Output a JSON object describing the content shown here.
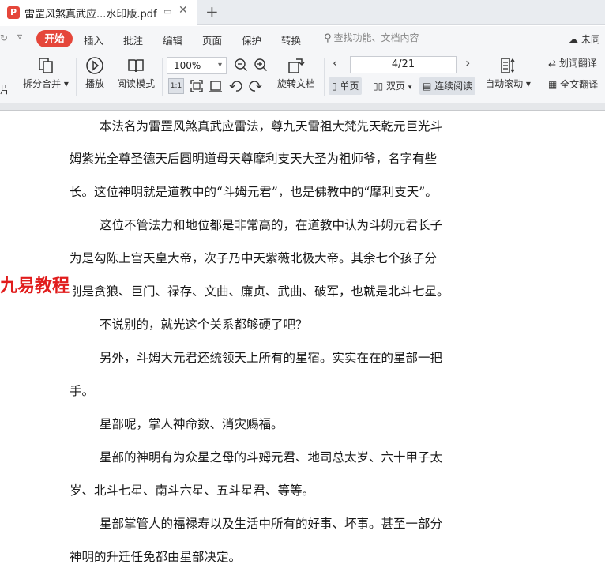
{
  "tab": {
    "title": "雷罡风煞真武应...水印版.pdf",
    "pdf_icon": "P",
    "pin": "▭",
    "close": "✕",
    "new_tab": "+"
  },
  "menu": {
    "left_undo": "↻",
    "caret": "▿",
    "items": [
      "开始",
      "插入",
      "批注",
      "编辑",
      "页面",
      "保护",
      "转换"
    ],
    "search_placeholder": "查找功能、文档内容",
    "sync_label": "未同"
  },
  "toolbar": {
    "left_partial": "片",
    "split_merge": "拆分合并",
    "play": "播放",
    "read_mode": "阅读模式",
    "zoom_value": "100%",
    "rotate_doc": "旋转文档",
    "page_indicator": "4/21",
    "single_page": "单页",
    "double_page": "双页",
    "continuous": "连续阅读",
    "auto_scroll": "自动滚动",
    "word_translate": "划词翻译",
    "full_translate": "全文翻译"
  },
  "document": {
    "lines": [
      "本法名为雷罡风煞真武应雷法，尊九天雷祖大梵先天乾元巨光斗",
      "姆紫光全尊圣德天后圆明道母天尊摩利支天大圣为祖师爷，名字有些",
      "长。这位神明就是道教中的“斗姆元君”，也是佛教中的“摩利支天”。",
      "这位不管法力和地位都是非常高的，在道教中认为斗姆元君长子",
      "为是勾陈上宫天皇大帝，次子乃中天紫薇北极大帝。其余七个孩子分",
      "别是贪狼、巨门、禄存、文曲、廉贞、武曲、破军，也就是北斗七星。",
      "不说别的，就光这个关系都够硬了吧？",
      "另外，斗姆大元君还统领天上所有的星宿。实实在在的星部一把",
      "手。",
      "星部呢，掌人神命数、消灾赐福。",
      "星部的神明有为众星之母的斗姆元君、地司总太岁、六十甲子太",
      "岁、北斗七星、南斗六星、五斗星君、等等。",
      "星部掌管人的福禄寿以及生活中所有的好事、坏事。甚至一部分",
      "神明的升迁任免都由星部决定。"
    ],
    "watermark": "九易教程"
  }
}
